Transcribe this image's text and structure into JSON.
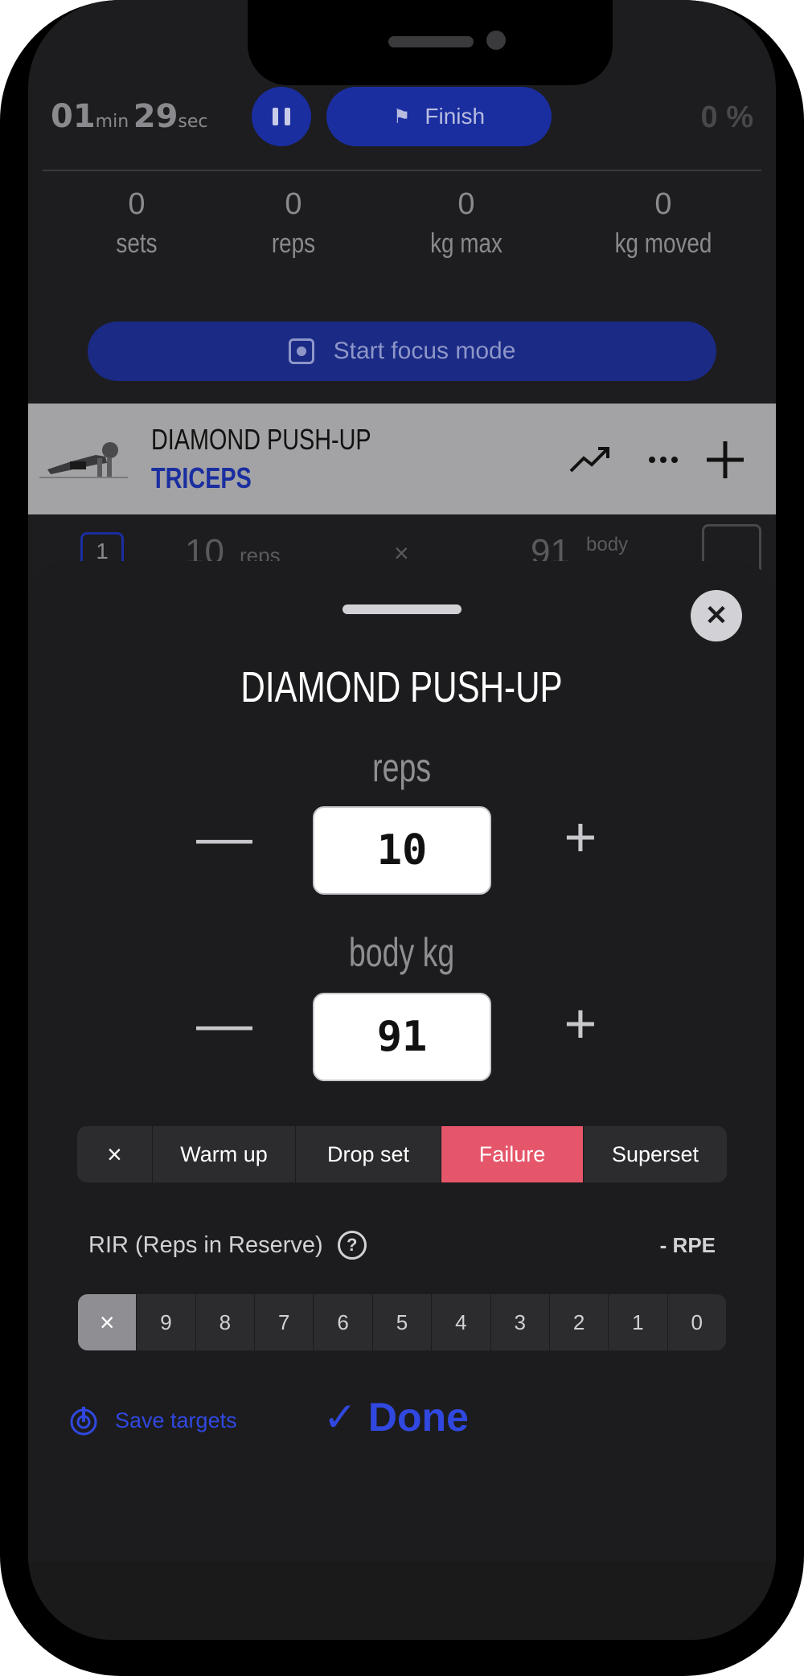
{
  "top_bar": {
    "timer_min": "01",
    "timer_min_unit": "min",
    "timer_sec": "29",
    "timer_sec_unit": "sec",
    "finish_label": "Finish",
    "progress_percent": "0 %"
  },
  "stats": [
    {
      "value": "0",
      "label": "sets"
    },
    {
      "value": "0",
      "label": "reps"
    },
    {
      "value": "0",
      "label": "kg max"
    },
    {
      "value": "0",
      "label": "kg moved"
    }
  ],
  "focus_label": "Start focus mode",
  "exercise": {
    "name": "DIAMOND PUSH-UP",
    "muscle": "TRICEPS",
    "icons": [
      "trend-up-icon",
      "more-icon",
      "add-icon"
    ]
  },
  "set_row": {
    "number": "1",
    "reps_value": "10",
    "reps_unit": "reps",
    "separator": "×",
    "weight_value": "91",
    "weight_unit": "body"
  },
  "sheet": {
    "title": "DIAMOND PUSH-UP",
    "reps_label": "reps",
    "reps_value": "10",
    "weight_label": "body kg",
    "weight_value": "91",
    "minus": "—",
    "plus": "+",
    "set_types": [
      {
        "label": "×",
        "active": false
      },
      {
        "label": "Warm up",
        "active": false
      },
      {
        "label": "Drop set",
        "active": false
      },
      {
        "label": "Failure",
        "active": true
      },
      {
        "label": "Superset",
        "active": false
      }
    ],
    "rir_label": "RIR (Reps in Reserve)",
    "help": "?",
    "rpe_label": "- RPE",
    "rir_options": [
      "×",
      "9",
      "8",
      "7",
      "6",
      "5",
      "4",
      "3",
      "2",
      "1",
      "0"
    ],
    "rir_selected": "×",
    "save_targets_label": "Save targets",
    "done_label": "Done",
    "done_check": "✓"
  },
  "colors": {
    "accent_blue": "#1a2ea0",
    "link_blue": "#3048e0",
    "failure_red": "#e5566a",
    "sheet_bg": "#1c1c1e"
  }
}
